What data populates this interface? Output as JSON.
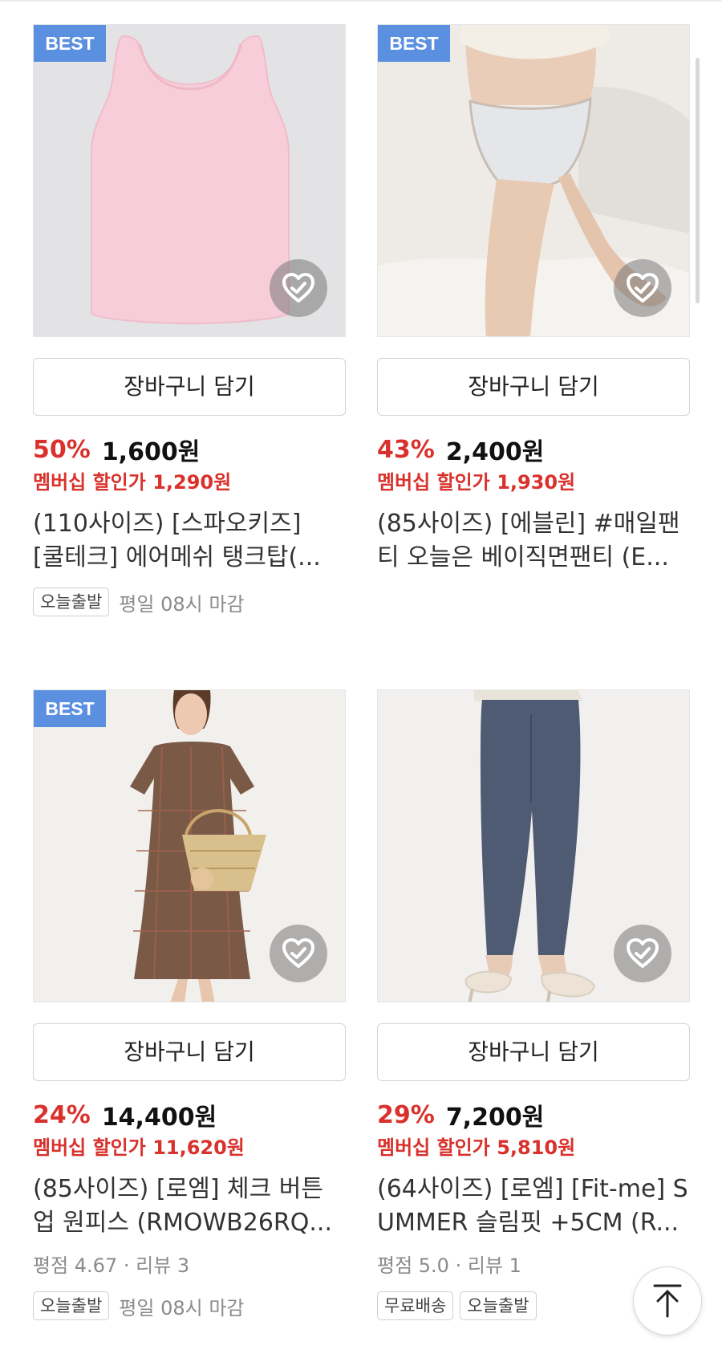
{
  "products": [
    {
      "badge": "BEST",
      "cart_label": "장바구니 담기",
      "discount": "50%",
      "price": "1,600원",
      "member_price": "멤버십 할인가 1,290원",
      "title_line1": "(110사이즈) [스파오키즈]",
      "title_line2": "[쿨테크] 에어메쉬 탱크탑(...",
      "tag1": "오늘출발",
      "tag_note": "평일 08시 마감"
    },
    {
      "badge": "BEST",
      "cart_label": "장바구니 담기",
      "discount": "43%",
      "price": "2,400원",
      "member_price": "멤버십 할인가 1,930원",
      "title_line1": "(85사이즈) [에블린] #매일팬",
      "title_line2": "티 오늘은 베이직면팬티 (E..."
    },
    {
      "badge": "BEST",
      "cart_label": "장바구니 담기",
      "discount": "24%",
      "price": "14,400원",
      "member_price": "멤버십 할인가 11,620원",
      "title_line1": "(85사이즈) [로엠] 체크 버튼",
      "title_line2": "업 원피스 (RMOWB26RQ...",
      "rating": "평점 4.67 · 리뷰 3",
      "tag1": "오늘출발",
      "tag_note": "평일 08시 마감"
    },
    {
      "cart_label": "장바구니 담기",
      "discount": "29%",
      "price": "7,200원",
      "member_price": "멤버십 할인가 5,810원",
      "title_line1": "(64사이즈) [로엠] [Fit-me] S",
      "title_line2": "UMMER 슬림핏 +5CM (R...",
      "rating": "평점 5.0 · 리뷰 1",
      "tag1": "무료배송",
      "tag2": "오늘출발"
    }
  ],
  "icons": {
    "wishlist": "heart-check-icon",
    "scroll_top": "arrow-up-icon"
  },
  "colors": {
    "discount": "#d9312c",
    "best_badge": "#5b8fe0"
  }
}
